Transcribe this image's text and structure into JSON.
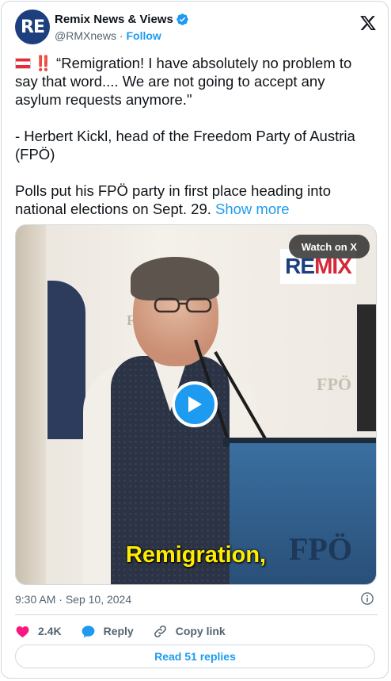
{
  "author": {
    "avatar_text": "RE",
    "display_name": "Remix News & Views",
    "handle": "@RMXnews",
    "separator": "·",
    "follow_label": "Follow"
  },
  "tweet": {
    "flag_emoji_name": "austria-flag",
    "emphasis": "‼️",
    "line1": "“Remigration! I have absolutely no problem to say that word.... We are not going to accept any asylum requests anymore.\"",
    "line2": "- Herbert Kickl, head of the Freedom Party of Austria (FPÖ)",
    "line3": "Polls put his FPÖ party in first place heading into national elections on Sept. 29.",
    "show_more": "Show more"
  },
  "video": {
    "watch_label": "Watch on X",
    "logo_re": "RE",
    "logo_mix": "MIX",
    "caption": "Remigration,"
  },
  "meta": {
    "time": "9:30 AM",
    "separator": "·",
    "date": "Sep 10, 2024"
  },
  "actions": {
    "likes": "2.4K",
    "reply_label": "Reply",
    "copy_label": "Copy link"
  },
  "replies_button": "Read 51 replies",
  "colors": {
    "accent": "#1d9bf0",
    "like": "#f91880",
    "text": "#0f1419",
    "muted": "#536471",
    "caption": "#ffec00"
  }
}
